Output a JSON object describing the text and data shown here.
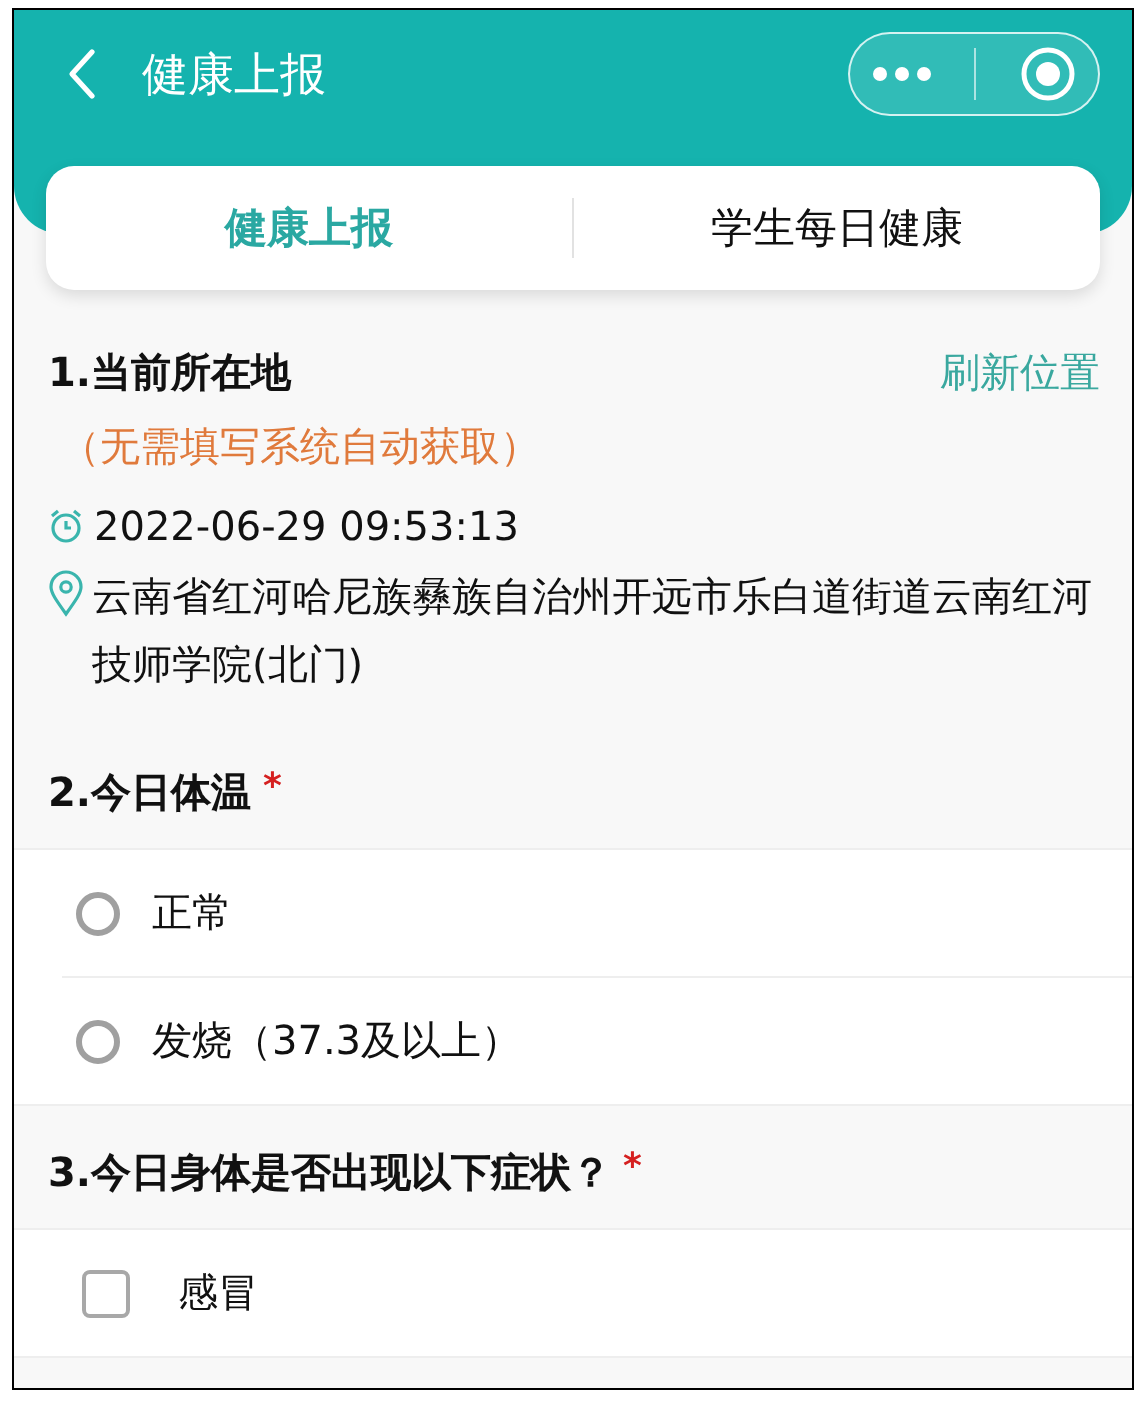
{
  "header": {
    "title": "健康上报"
  },
  "tabs": [
    {
      "label": "健康上报",
      "selected": true
    },
    {
      "label": "学生每日健康",
      "selected": false
    }
  ],
  "location": {
    "title": "1.当前所在地",
    "refresh": "刷新位置",
    "note": "（无需填写系统自动获取）",
    "time": "2022-06-29 09:53:13",
    "address": "云南省红河哈尼族彝族自治州开远市乐白道街道云南红河技师学院(北门)"
  },
  "questions": [
    {
      "title": "2.今日体温",
      "required_mark": "*",
      "kind": "radio",
      "options": [
        {
          "label": "正常",
          "selected": false
        },
        {
          "label": "发烧（37.3及以上）",
          "selected": false
        }
      ]
    },
    {
      "title": "3.今日身体是否出现以下症状？",
      "required_mark": "*",
      "kind": "checkbox",
      "options": [
        {
          "label": "感冒",
          "checked": false
        }
      ]
    }
  ]
}
